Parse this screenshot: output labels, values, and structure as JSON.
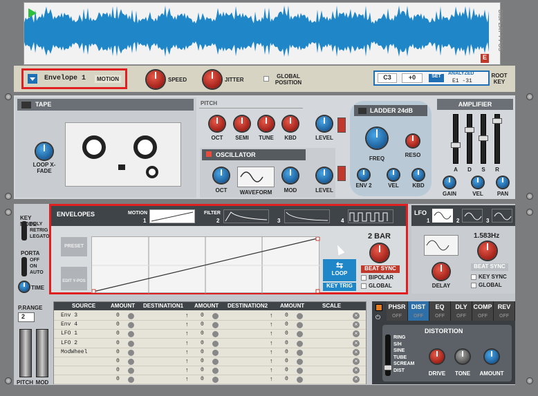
{
  "waveform": {
    "display_label": "DISPLAY Y POS",
    "marker": "E"
  },
  "top_controls": {
    "mod_source": "Envelope 1",
    "mod_dest": "MOTION",
    "speed_label": "SPEED",
    "jitter_label": "JITTER",
    "global_position_label": "GLOBAL POSITION",
    "root_note": "C3",
    "transpose": "+0",
    "set_label": "SET",
    "analyzed_label": "ANALYZED",
    "analyzed_value": "E1 -31",
    "root_key_label": "ROOT KEY"
  },
  "tape": {
    "title": "TAPE",
    "loop_xfade_label": "LOOP X-FADE"
  },
  "pitch": {
    "title": "PITCH",
    "knobs": [
      "OCT",
      "SEMI",
      "TUNE",
      "KBD"
    ],
    "level_label": "LEVEL"
  },
  "oscillator": {
    "title": "OSCILLATOR",
    "oct_label": "OCT",
    "waveform_label": "WAVEFORM",
    "mod_label": "MOD",
    "level_label": "LEVEL"
  },
  "filter": {
    "title": "LADDER 24dB",
    "freq_label": "FREQ",
    "reso_label": "RESO",
    "env2_label": "ENV 2",
    "vel_label": "VEL",
    "kbd_label": "KBD"
  },
  "amplifier": {
    "title": "AMPLIFIER",
    "adsr": [
      "A",
      "D",
      "S",
      "R"
    ],
    "gain_label": "GAIN",
    "vel_label": "VEL",
    "pan_label": "PAN"
  },
  "left_panel": {
    "key_mode_label": "KEY MODE",
    "key_modes": [
      "POLY",
      "RETRIG",
      "LEGATO"
    ],
    "porta_label": "PORTA",
    "porta_modes": [
      "OFF",
      "ON",
      "AUTO"
    ],
    "time_label": "TIME",
    "prange_label": "P.RANGE",
    "prange_value": "2",
    "pitch_label": "PITCH",
    "mod_label": "MOD"
  },
  "envelopes": {
    "title": "ENVELOPES",
    "tabs": [
      {
        "label": "MOTION",
        "num": "1"
      },
      {
        "label": "FILTER",
        "num": "2"
      },
      {
        "label": "",
        "num": "3"
      },
      {
        "label": "",
        "num": "4"
      }
    ],
    "preset_label": "PRESET",
    "edit_label": "EDIT Y-POS",
    "rate": "2 BAR",
    "beat_sync": "BEAT SYNC",
    "bipolar": "BIPOLAR",
    "global": "GLOBAL",
    "loop": "LOOP",
    "key_trig": "KEY TRIG"
  },
  "lfo": {
    "title": "LFO",
    "tab_nums": [
      "1",
      "2",
      "3"
    ],
    "rate": "1.583Hz",
    "beat_sync": "BEAT SYNC",
    "delay_label": "DELAY",
    "key_sync": "KEY SYNC",
    "global": "GLOBAL"
  },
  "mod_matrix": {
    "headers": [
      "SOURCE",
      "AMOUNT",
      "DESTINATION1",
      "AMOUNT",
      "DESTINATION2",
      "AMOUNT",
      "SCALE"
    ],
    "rows": [
      {
        "source": "Env 3",
        "a1": "0",
        "a2": "0",
        "a3": "0"
      },
      {
        "source": "Env 4",
        "a1": "0",
        "a2": "0",
        "a3": "0"
      },
      {
        "source": "LFO 1",
        "a1": "0",
        "a2": "0",
        "a3": "0"
      },
      {
        "source": "LFO 2",
        "a1": "0",
        "a2": "0",
        "a3": "0"
      },
      {
        "source": "ModWheel",
        "a1": "0",
        "a2": "0",
        "a3": "0"
      },
      {
        "source": "",
        "a1": "0",
        "a2": "0",
        "a3": "0"
      },
      {
        "source": "",
        "a1": "0",
        "a2": "0",
        "a3": "0"
      },
      {
        "source": "",
        "a1": "0",
        "a2": "0",
        "a3": "0"
      }
    ]
  },
  "effects": {
    "tabs": [
      "PHSR",
      "DIST",
      "EQ",
      "DLY",
      "COMP",
      "REV"
    ],
    "off_label": "OFF",
    "active_tab": "DIST",
    "distortion_title": "DISTORTION",
    "modes": [
      "RING",
      "S/H",
      "SINE",
      "TUBE",
      "SCREAM",
      "DIST"
    ],
    "drive_label": "DRIVE",
    "tone_label": "TONE",
    "amount_label": "AMOUNT"
  },
  "colors": {
    "accent_blue": "#1f86c8",
    "highlight_red": "#e02020",
    "panel_light": "#e8e4d6"
  }
}
